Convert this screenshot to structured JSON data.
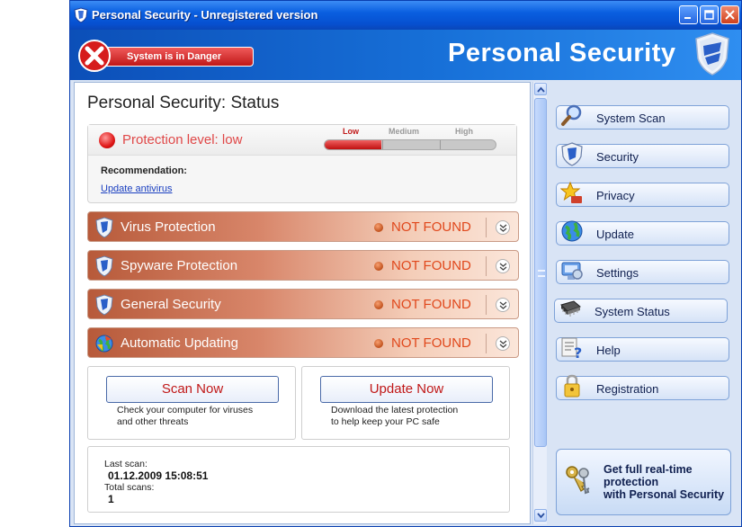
{
  "window": {
    "title": "Personal Security - Unregistered version"
  },
  "header": {
    "danger_label": "System is in Danger",
    "brand": "Personal Security"
  },
  "main": {
    "title": "Personal Security: Status",
    "protection": {
      "level_text": "Protection level: low",
      "levels": [
        "Low",
        "Medium",
        "High"
      ],
      "current_level_fraction": 0.33,
      "recommendation_label": "Recommendation:",
      "recommendation_link": "Update antivirus"
    },
    "components": [
      {
        "name": "Virus Protection",
        "state": "NOT FOUND",
        "icon": "shield-icon"
      },
      {
        "name": "Spyware Protection",
        "state": "NOT FOUND",
        "icon": "shield-icon"
      },
      {
        "name": "General Security",
        "state": "NOT FOUND",
        "icon": "shield-icon"
      },
      {
        "name": "Automatic Updating",
        "state": "NOT FOUND",
        "icon": "globe-icon"
      }
    ],
    "actions": [
      {
        "label": "Scan Now",
        "desc_line1": "Check your computer for viruses",
        "desc_line2": "and other threats"
      },
      {
        "label": "Update Now",
        "desc_line1": "Download the latest protection",
        "desc_line2": "to help keep your PC safe"
      }
    ],
    "scan_info": {
      "last_scan_label": "Last scan:",
      "last_scan_value": "01.12.2009 15:08:51",
      "total_scans_label": "Total scans:",
      "total_scans_value": "1"
    }
  },
  "nav": [
    {
      "label": "System Scan",
      "icon": "magnifier-icon"
    },
    {
      "label": "Security",
      "icon": "shield-icon"
    },
    {
      "label": "Privacy",
      "icon": "star-icon"
    },
    {
      "label": "Update",
      "icon": "globe-icon"
    },
    {
      "label": "Settings",
      "icon": "settings-icon"
    },
    {
      "label": "System Status",
      "icon": "chip-icon"
    },
    {
      "label": "Help",
      "icon": "help-icon"
    },
    {
      "label": "Registration",
      "icon": "lock-icon"
    }
  ],
  "promo": {
    "line1": "Get full real-time",
    "line2": "protection",
    "line3": "with Personal Security",
    "icon": "keys-icon"
  },
  "colors": {
    "title_bar": "#0a5fe0",
    "danger": "#c01818",
    "not_found": "#e0481c",
    "component_bar": "#b75a3a"
  }
}
